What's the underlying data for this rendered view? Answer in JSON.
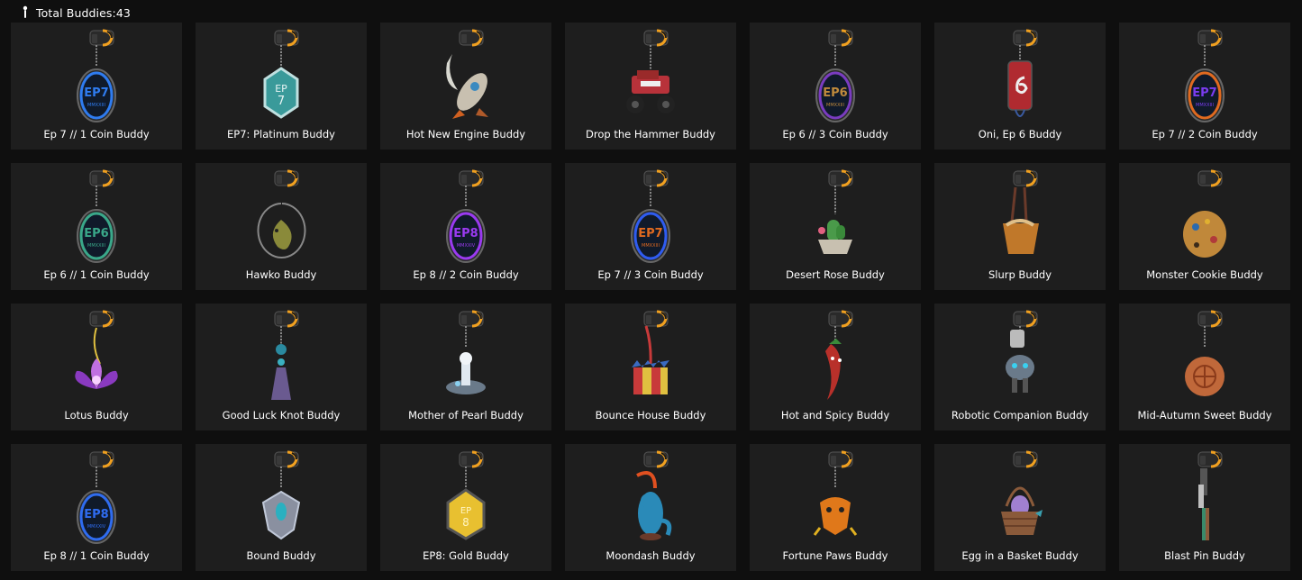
{
  "header": {
    "label": "Total Buddies:43",
    "icon": "buddy-charm-icon"
  },
  "buddies": [
    {
      "name": "Ep 7 // 1 Coin Buddy",
      "kind": "coin",
      "color": "#2f7cf0",
      "text": "EP7",
      "sub": "MMXXIII"
    },
    {
      "name": "EP7: Platinum Buddy",
      "kind": "plate",
      "color": "#4aa8a8",
      "text": "EP",
      "text2": "7"
    },
    {
      "name": "Hot New Engine Buddy",
      "kind": "rocket",
      "color": "#b06a30"
    },
    {
      "name": "Drop the Hammer Buddy",
      "kind": "truck",
      "color": "#b8323a"
    },
    {
      "name": "Ep 6 // 3 Coin Buddy",
      "kind": "coin",
      "color": "#c08a3c",
      "text": "EP6",
      "sub": "MMXXIII",
      "inner": "#7a3cc0"
    },
    {
      "name": "Oni, Ep 6 Buddy",
      "kind": "can",
      "color": "#b02a30"
    },
    {
      "name": "Ep 7 // 2 Coin Buddy",
      "kind": "coin",
      "color": "#7a3cf0",
      "text": "EP7",
      "sub": "MMXXIII",
      "inner": "#e06a20"
    },
    {
      "name": "Ep 6 // 1 Coin Buddy",
      "kind": "coin",
      "color": "#3aa88a",
      "text": "EP6",
      "sub": "MMXXIII"
    },
    {
      "name": "Hawko Buddy",
      "kind": "hawk",
      "color": "#8a8a3a"
    },
    {
      "name": "Ep 8 // 2 Coin Buddy",
      "kind": "coin",
      "color": "#9a3af0",
      "text": "EP8",
      "sub": "MMXXIV"
    },
    {
      "name": "Ep 7 // 3 Coin Buddy",
      "kind": "coin",
      "color": "#e06a20",
      "text": "EP7",
      "sub": "MMXXIII",
      "inner": "#2f5cf0"
    },
    {
      "name": "Desert Rose Buddy",
      "kind": "cactus",
      "color": "#4a9a4a"
    },
    {
      "name": "Slurp Buddy",
      "kind": "noodle",
      "color": "#c0782a"
    },
    {
      "name": "Monster Cookie Buddy",
      "kind": "cookie",
      "color": "#c0883a"
    },
    {
      "name": "Lotus Buddy",
      "kind": "lotus",
      "color": "#9a4ad0"
    },
    {
      "name": "Good Luck Knot Buddy",
      "kind": "tassel",
      "color": "#6a5a90"
    },
    {
      "name": "Mother of Pearl Buddy",
      "kind": "pearl",
      "color": "#8aa0b0"
    },
    {
      "name": "Bounce House Buddy",
      "kind": "house",
      "color": "#c83a3a"
    },
    {
      "name": "Hot and Spicy Buddy",
      "kind": "pepper",
      "color": "#b8302a"
    },
    {
      "name": "Robotic Companion Buddy",
      "kind": "robot",
      "color": "#7a8a9a"
    },
    {
      "name": "Mid-Autumn Sweet Buddy",
      "kind": "mooncake",
      "color": "#c0683a"
    },
    {
      "name": "Ep 8 // 1 Coin Buddy",
      "kind": "coin",
      "color": "#2f6cf0",
      "text": "EP8",
      "sub": "MMXXIV"
    },
    {
      "name": "Bound Buddy",
      "kind": "bound",
      "color": "#a0a8b8"
    },
    {
      "name": "EP8: Gold Buddy",
      "kind": "gold",
      "color": "#e0b030",
      "text": "EP",
      "text2": "8"
    },
    {
      "name": "Moondash Buddy",
      "kind": "moondash",
      "color": "#2a8ab8"
    },
    {
      "name": "Fortune Paws Buddy",
      "kind": "paws",
      "color": "#e0781a"
    },
    {
      "name": "Egg in a Basket Buddy",
      "kind": "basket",
      "color": "#8a5a3a"
    },
    {
      "name": "Blast Pin Buddy",
      "kind": "blastpin",
      "color": "#3a8a6a"
    }
  ]
}
